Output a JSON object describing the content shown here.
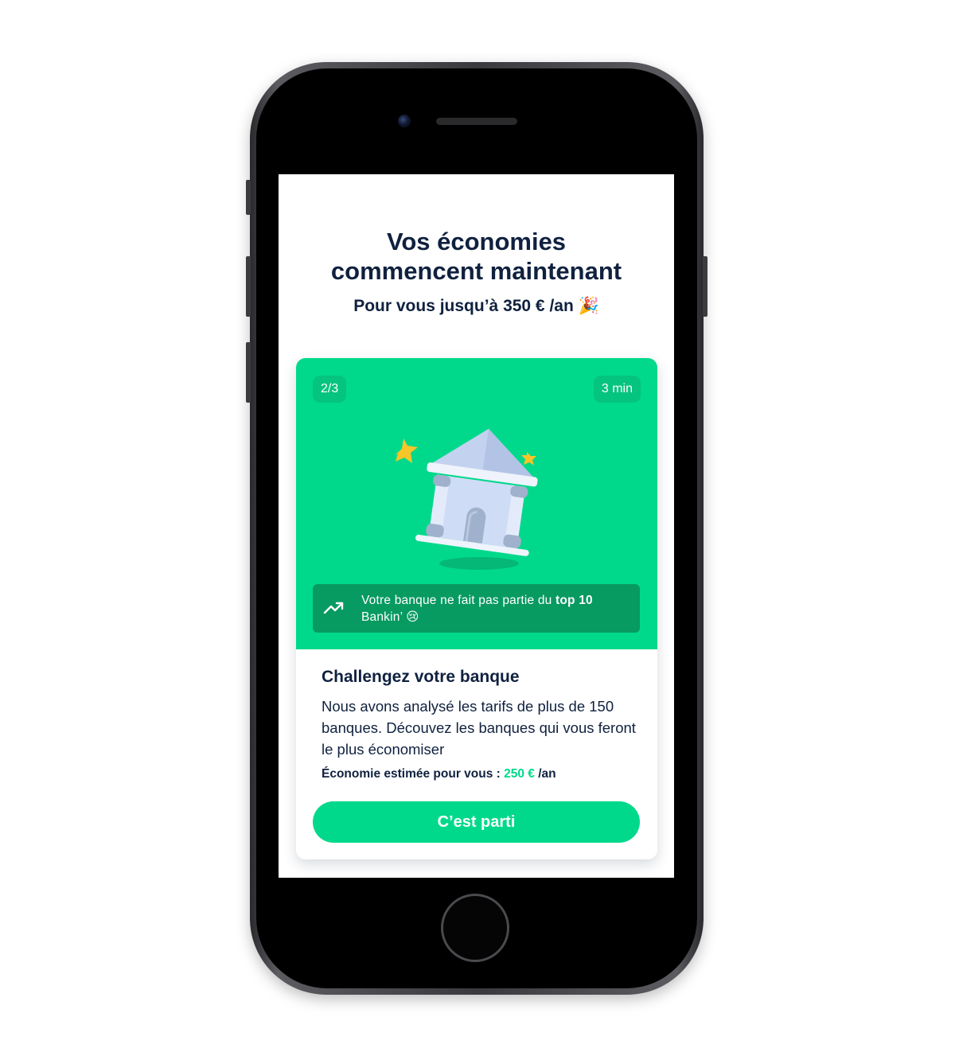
{
  "header": {
    "title_line1": "Vos économies",
    "title_line2": "commencent maintenant",
    "subtitle": "Pour vous jusqu’à 350 € /an",
    "subtitle_emoji": "🎉"
  },
  "card": {
    "step": "2/3",
    "duration": "3 min",
    "illustration_icon": "bank-building-icon",
    "info": {
      "icon": "trending-up-icon",
      "text_before": "Votre banque ne fait pas partie du ",
      "text_bold": "top 10",
      "text_after": " Bankin’ ",
      "emoji": "😢"
    },
    "title": "Challengez votre banque",
    "description": "Nous avons analysé les tarifs de plus de 150 banques. Découvez les banques qui vous feront le plus économiser",
    "estimate_label": "Économie estimée pour vous : ",
    "estimate_value": "250 €",
    "estimate_unit": " /an",
    "cta_label": "C’est parti"
  },
  "colors": {
    "accent_green": "#00d98b",
    "dark_green": "#079a61",
    "text_navy": "#10213f"
  }
}
